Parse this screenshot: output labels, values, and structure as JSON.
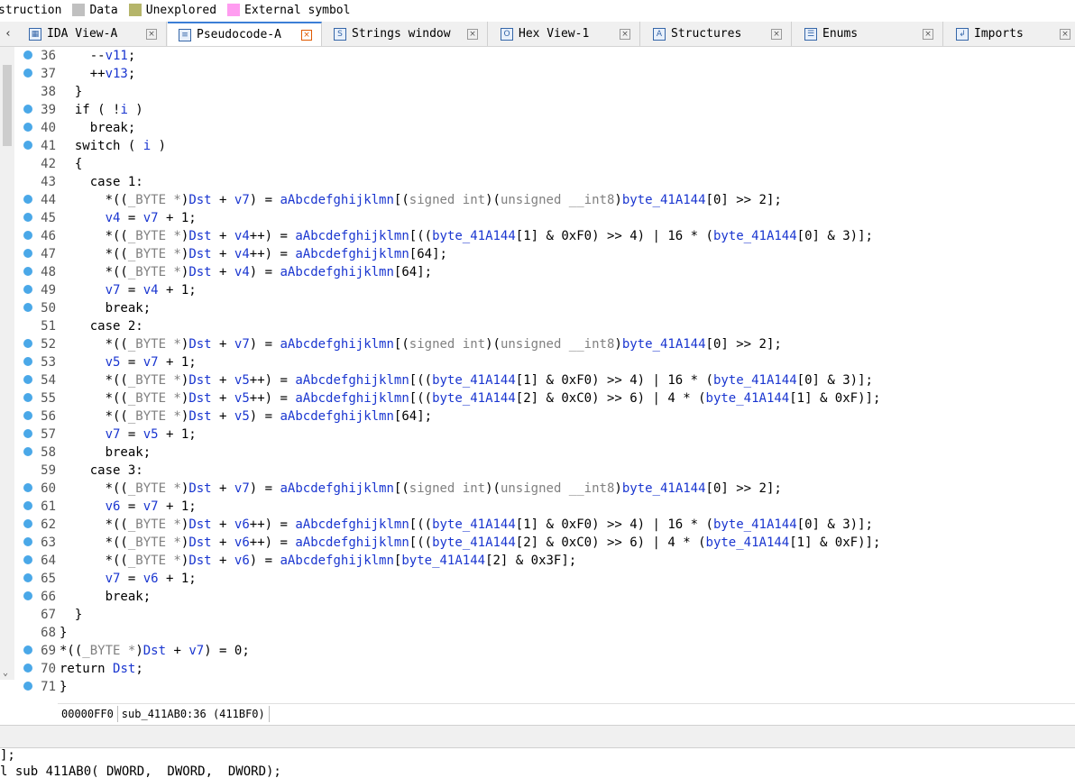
{
  "legend": [
    {
      "label": "struction",
      "color": ""
    },
    {
      "label": "Data",
      "color": "#c0c0c0"
    },
    {
      "label": "Unexplored",
      "color": "#b5b56a"
    },
    {
      "label": "External symbol",
      "color": "#ff9cf0"
    }
  ],
  "tabs": [
    {
      "label": "IDA View-A",
      "icon": "graph-icon",
      "active": false
    },
    {
      "label": "Pseudocode-A",
      "icon": "pseudocode-icon",
      "active": true
    },
    {
      "label": "Strings window",
      "icon": "strings-icon",
      "active": false
    },
    {
      "label": "Hex View-1",
      "icon": "hex-icon",
      "active": false
    },
    {
      "label": "Structures",
      "icon": "structures-icon",
      "active": false
    },
    {
      "label": "Enums",
      "icon": "enums-icon",
      "active": false
    },
    {
      "label": "Imports",
      "icon": "imports-icon",
      "active": false
    }
  ],
  "code_lines": [
    {
      "n": "36",
      "dot": true,
      "text": "    --v11;"
    },
    {
      "n": "37",
      "dot": true,
      "text": "    ++v13;"
    },
    {
      "n": "38",
      "dot": false,
      "text": "  }"
    },
    {
      "n": "39",
      "dot": true,
      "text": "  if ( !i )"
    },
    {
      "n": "40",
      "dot": true,
      "text": "    break;"
    },
    {
      "n": "41",
      "dot": true,
      "text": "  switch ( i )"
    },
    {
      "n": "42",
      "dot": false,
      "text": "  {"
    },
    {
      "n": "43",
      "dot": false,
      "text": "    case 1:"
    },
    {
      "n": "44",
      "dot": true,
      "text": "      *((_BYTE *)Dst + v7) = aAbcdefghijklmn[(signed int)(unsigned __int8)byte_41A144[0] >> 2];"
    },
    {
      "n": "45",
      "dot": true,
      "text": "      v4 = v7 + 1;"
    },
    {
      "n": "46",
      "dot": true,
      "text": "      *((_BYTE *)Dst + v4++) = aAbcdefghijklmn[((byte_41A144[1] & 0xF0) >> 4) | 16 * (byte_41A144[0] & 3)];"
    },
    {
      "n": "47",
      "dot": true,
      "text": "      *((_BYTE *)Dst + v4++) = aAbcdefghijklmn[64];"
    },
    {
      "n": "48",
      "dot": true,
      "text": "      *((_BYTE *)Dst + v4) = aAbcdefghijklmn[64];"
    },
    {
      "n": "49",
      "dot": true,
      "text": "      v7 = v4 + 1;"
    },
    {
      "n": "50",
      "dot": true,
      "text": "      break;"
    },
    {
      "n": "51",
      "dot": false,
      "text": "    case 2:"
    },
    {
      "n": "52",
      "dot": true,
      "text": "      *((_BYTE *)Dst + v7) = aAbcdefghijklmn[(signed int)(unsigned __int8)byte_41A144[0] >> 2];"
    },
    {
      "n": "53",
      "dot": true,
      "text": "      v5 = v7 + 1;"
    },
    {
      "n": "54",
      "dot": true,
      "text": "      *((_BYTE *)Dst + v5++) = aAbcdefghijklmn[((byte_41A144[1] & 0xF0) >> 4) | 16 * (byte_41A144[0] & 3)];"
    },
    {
      "n": "55",
      "dot": true,
      "text": "      *((_BYTE *)Dst + v5++) = aAbcdefghijklmn[((byte_41A144[2] & 0xC0) >> 6) | 4 * (byte_41A144[1] & 0xF)];"
    },
    {
      "n": "56",
      "dot": true,
      "text": "      *((_BYTE *)Dst + v5) = aAbcdefghijklmn[64];"
    },
    {
      "n": "57",
      "dot": true,
      "text": "      v7 = v5 + 1;"
    },
    {
      "n": "58",
      "dot": true,
      "text": "      break;"
    },
    {
      "n": "59",
      "dot": false,
      "text": "    case 3:"
    },
    {
      "n": "60",
      "dot": true,
      "text": "      *((_BYTE *)Dst + v7) = aAbcdefghijklmn[(signed int)(unsigned __int8)byte_41A144[0] >> 2];"
    },
    {
      "n": "61",
      "dot": true,
      "text": "      v6 = v7 + 1;"
    },
    {
      "n": "62",
      "dot": true,
      "text": "      *((_BYTE *)Dst + v6++) = aAbcdefghijklmn[((byte_41A144[1] & 0xF0) >> 4) | 16 * (byte_41A144[0] & 3)];"
    },
    {
      "n": "63",
      "dot": true,
      "text": "      *((_BYTE *)Dst + v6++) = aAbcdefghijklmn[((byte_41A144[2] & 0xC0) >> 6) | 4 * (byte_41A144[1] & 0xF)];"
    },
    {
      "n": "64",
      "dot": true,
      "text": "      *((_BYTE *)Dst + v6) = aAbcdefghijklmn[byte_41A144[2] & 0x3F];"
    },
    {
      "n": "65",
      "dot": true,
      "text": "      v7 = v6 + 1;"
    },
    {
      "n": "66",
      "dot": true,
      "text": "      break;"
    },
    {
      "n": "67",
      "dot": false,
      "text": "  }"
    },
    {
      "n": "68",
      "dot": false,
      "text": "}"
    },
    {
      "n": "69",
      "dot": true,
      "text": "*((_BYTE *)Dst + v7) = 0;"
    },
    {
      "n": "70",
      "dot": true,
      "text": "return Dst;"
    },
    {
      "n": "71",
      "dot": true,
      "text": "}"
    }
  ],
  "status": {
    "address": "00000FF0",
    "location": "sub_411AB0:36 (411BF0)"
  },
  "output": {
    "line1": "];",
    "line2": "l sub 411AB0( DWORD,  DWORD,  DWORD);"
  },
  "colors": {
    "accent": "#3c7fd6",
    "breakpoint_dot": "#4aa8e8",
    "identifier": "#1a36d0",
    "type": "#808080"
  }
}
